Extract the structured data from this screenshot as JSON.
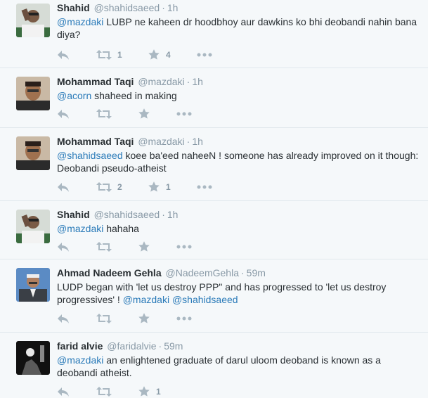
{
  "tweets": [
    {
      "name": "Shahid",
      "handle": "@shahidsaeed",
      "time": "1h",
      "text_parts": [
        {
          "text": "@mazdaki",
          "mention": true
        },
        {
          "text": " LUBP ne kaheen dr hoodbhoy aur dawkins ko bhi deobandi nahin bana diya?",
          "mention": false
        }
      ],
      "retweets": "1",
      "favorites": "4"
    },
    {
      "name": "Mohammad Taqi",
      "handle": "@mazdaki",
      "time": "1h",
      "text_parts": [
        {
          "text": "@acorn",
          "mention": true
        },
        {
          "text": " shaheed in making",
          "mention": false
        }
      ],
      "retweets": "",
      "favorites": ""
    },
    {
      "name": "Mohammad Taqi",
      "handle": "@mazdaki",
      "time": "1h",
      "text_parts": [
        {
          "text": "@shahidsaeed",
          "mention": true
        },
        {
          "text": " koee ba'eed naheeN ! someone has already improved on it though: Deobandi pseudo-atheist",
          "mention": false
        }
      ],
      "retweets": "2",
      "favorites": "1"
    },
    {
      "name": "Shahid",
      "handle": "@shahidsaeed",
      "time": "1h",
      "text_parts": [
        {
          "text": "@mazdaki",
          "mention": true
        },
        {
          "text": " hahaha",
          "mention": false
        }
      ],
      "retweets": "",
      "favorites": ""
    },
    {
      "name": "Ahmad Nadeem Gehla",
      "handle": "@NadeemGehla",
      "time": "59m",
      "text_parts": [
        {
          "text": "LUDP began with 'let us destroy PPP\" and has progressed to 'let us destroy progressives' ! ",
          "mention": false
        },
        {
          "text": "@mazdaki",
          "mention": true
        },
        {
          "text": " ",
          "mention": false
        },
        {
          "text": "@shahidsaeed",
          "mention": true
        }
      ],
      "retweets": "",
      "favorites": ""
    },
    {
      "name": "farid alvie",
      "handle": "@faridalvie",
      "time": "59m",
      "text_parts": [
        {
          "text": "@mazdaki",
          "mention": true
        },
        {
          "text": " an enlightened graduate of darul uloom deoband is known as a deobandi atheist.",
          "mention": false
        }
      ],
      "retweets": "",
      "favorites": "1"
    }
  ],
  "separator": "·",
  "icons": {
    "reply": "reply-icon",
    "retweet": "retweet-icon",
    "favorite": "star-icon",
    "more": "more-icon"
  },
  "colors": {
    "background": "#f5f8fa",
    "mention": "#2b7bb9",
    "action_icon": "#aab8c2",
    "meta_text": "#8899a6"
  }
}
